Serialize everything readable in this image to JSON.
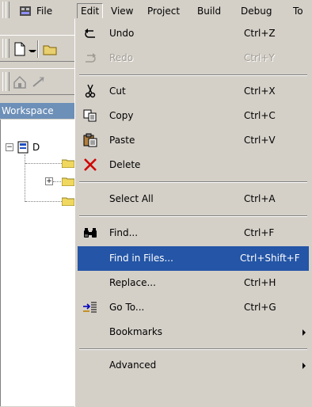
{
  "menubar": {
    "items": [
      {
        "label": "File"
      },
      {
        "label": "Edit"
      },
      {
        "label": "View"
      },
      {
        "label": "Project"
      },
      {
        "label": "Build"
      },
      {
        "label": "Debug"
      },
      {
        "label": "To"
      }
    ]
  },
  "workspace": {
    "title": "Workspace",
    "root_label": "D"
  },
  "edit_menu": {
    "items": [
      {
        "label": "Undo",
        "shortcut": "Ctrl+Z",
        "icon": "undo-icon",
        "enabled": true
      },
      {
        "label": "Redo",
        "shortcut": "Ctrl+Y",
        "icon": "redo-icon",
        "enabled": false
      },
      {
        "label": "Cut",
        "shortcut": "Ctrl+X",
        "icon": "scissors-icon",
        "enabled": true
      },
      {
        "label": "Copy",
        "shortcut": "Ctrl+C",
        "icon": "copy-icon",
        "enabled": true
      },
      {
        "label": "Paste",
        "shortcut": "Ctrl+V",
        "icon": "paste-icon",
        "enabled": true
      },
      {
        "label": "Delete",
        "shortcut": "",
        "icon": "delete-x-icon",
        "enabled": true
      },
      {
        "label": "Select All",
        "shortcut": "Ctrl+A",
        "enabled": true
      },
      {
        "label": "Find...",
        "shortcut": "Ctrl+F",
        "icon": "binoculars-icon",
        "enabled": true
      },
      {
        "label": "Find in Files...",
        "shortcut": "Ctrl+Shift+F",
        "enabled": true,
        "selected": true
      },
      {
        "label": "Replace...",
        "shortcut": "Ctrl+H",
        "enabled": true
      },
      {
        "label": "Go To...",
        "shortcut": "Ctrl+G",
        "icon": "goto-icon",
        "enabled": true
      },
      {
        "label": "Bookmarks",
        "shortcut": "",
        "submenu": true,
        "enabled": true
      },
      {
        "label": "Advanced",
        "shortcut": "",
        "submenu": true,
        "enabled": true
      }
    ]
  },
  "colors": {
    "face": "#d4d0c8",
    "highlight": "#2455a6",
    "titlebar": "#6d90b8",
    "disabled": "#a09c94"
  }
}
